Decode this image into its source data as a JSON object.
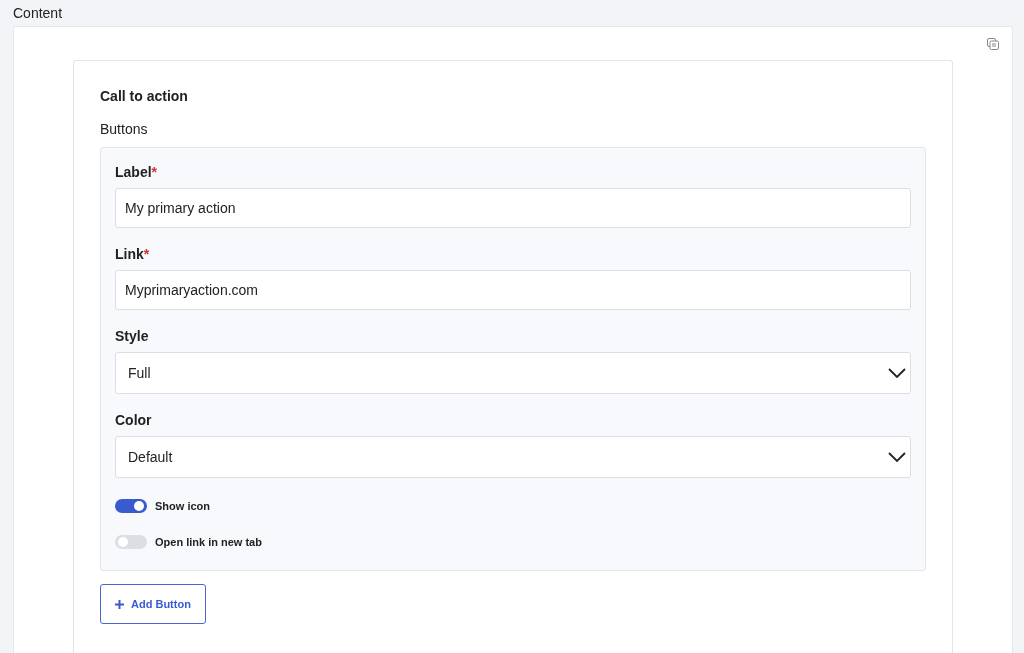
{
  "section_title": "Content",
  "block": {
    "title": "Call to action",
    "group_label": "Buttons",
    "fields": [
      {
        "kind": "text",
        "label": "Label",
        "required_mark": "*",
        "value": "My primary action"
      },
      {
        "kind": "text",
        "label": "Link",
        "required_mark": "*",
        "value": "Myprimaryaction.com"
      },
      {
        "kind": "select",
        "label": "Style",
        "value": "Full"
      },
      {
        "kind": "select",
        "label": "Color",
        "value": "Default"
      }
    ],
    "toggles": [
      {
        "label": "Show icon",
        "on": true
      },
      {
        "label": "Open link in new tab",
        "on": false
      }
    ],
    "add_button": "Add Button"
  }
}
